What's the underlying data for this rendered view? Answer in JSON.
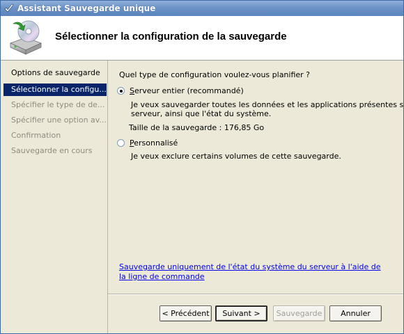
{
  "window": {
    "title": "Assistant Sauvegarde unique"
  },
  "header": {
    "title": "Sélectionner la configuration de la sauvegarde",
    "icon": "backup-disk-icon"
  },
  "sidebar": {
    "heading": "Options de sauvegarde",
    "steps": [
      {
        "label": "Sélectionner la configu...",
        "active": true
      },
      {
        "label": "Spécifier le type de de...",
        "active": false
      },
      {
        "label": "Spécifier une option av...",
        "active": false
      },
      {
        "label": "Confirmation",
        "active": false
      },
      {
        "label": "Sauvegarde en cours",
        "active": false
      }
    ]
  },
  "main": {
    "question": "Quel type de configuration voulez-vous planifier ?",
    "options": {
      "full": {
        "label_mnemonic": "S",
        "label_rest": "erveur entier (recommandé)",
        "checked": true,
        "desc_line1": "Je veux sauvegarder toutes les données et les applications présentes sur le",
        "desc_line2": "serveur, ainsi que l'état du système.",
        "size": "Taille de la sauvegarde : 176,85 Go"
      },
      "custom": {
        "label_mnemonic": "P",
        "label_rest": "ersonnalisé",
        "checked": false,
        "desc_line1": "Je veux exclure certains volumes de cette sauvegarde."
      }
    },
    "link": "Sauvegarde uniquement de l'état du système du serveur à l'aide de la ligne de commande"
  },
  "buttons": {
    "previous": "< Précédent",
    "next": "Suivant >",
    "backup": "Sauvegarde",
    "cancel": "Annuler"
  },
  "colors": {
    "selection": "#0a246a",
    "link": "#0000ee",
    "titlebar": "#6d93c6"
  }
}
